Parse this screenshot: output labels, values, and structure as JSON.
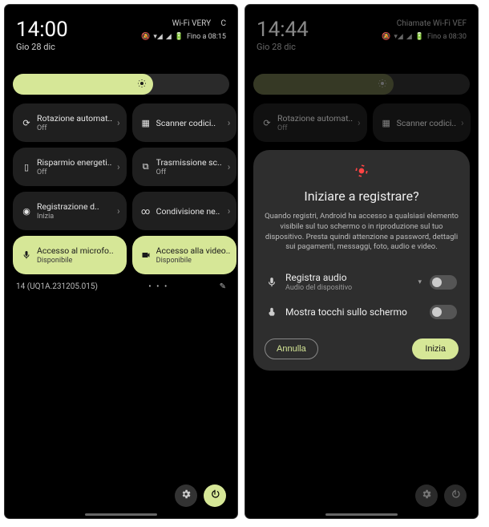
{
  "left": {
    "time": "14:00",
    "date": "Gio 28 dic",
    "carrier": "Wi-Fi VERY",
    "status_extra": "C",
    "battery": "Fino a 08:15",
    "tiles": [
      {
        "title": "Rotazione automat..",
        "sub": "Off"
      },
      {
        "title": "Scanner codici..",
        "sub": ""
      },
      {
        "title": "Risparmio energeti..",
        "sub": "Off"
      },
      {
        "title": "Trasmissione sc..",
        "sub": "Off"
      },
      {
        "title": "Registrazione d..",
        "sub": "Inizia"
      },
      {
        "title": "Condivisione ne..",
        "sub": ""
      },
      {
        "title": "Accesso al microfo..",
        "sub": "Disponibile"
      },
      {
        "title": "Accesso alla video..",
        "sub": "Disponibile"
      }
    ],
    "build": "14 (UQ1A.231205.015)"
  },
  "right": {
    "time": "14:44",
    "date": "Gio 28 dic",
    "carrier": "Chiamate Wi-Fi VEF",
    "battery": "Fino a 08:30",
    "tiles": [
      {
        "title": "Rotazione automat..",
        "sub": "Off"
      },
      {
        "title": "Scanner codici..",
        "sub": ""
      }
    ],
    "dialog": {
      "title": "Iniziare a registrare?",
      "body": "Quando registri, Android ha accesso a qualsiasi elemento visibile sul tuo schermo o in riproduzione sul tuo dispositivo. Presta quindi attenzione a password, dettagli sui pagamenti, messaggi, foto, audio e video.",
      "row1_title": "Registra audio",
      "row1_sub": "Audio del dispositivo",
      "row2_title": "Mostra tocchi sullo schermo",
      "cancel": "Annulla",
      "start": "Inizia"
    }
  }
}
